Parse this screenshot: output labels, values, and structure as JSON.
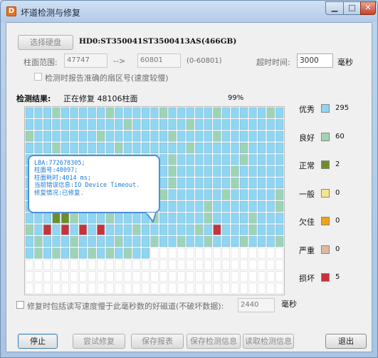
{
  "window": {
    "title": "坏道检测与修复",
    "app_icon_glyph": "D"
  },
  "disk": {
    "select_button": "选择硬盘",
    "name": "HD0:ST350041ST3500413AS(466GB)"
  },
  "range": {
    "label": "柱面范围:",
    "start": "47747",
    "arrow": "-->",
    "end": "60801",
    "total": "(0-60801)"
  },
  "timeout": {
    "label": "超时时间:",
    "value": "3000",
    "unit": "毫秒"
  },
  "accurate_check": {
    "label": "检测时报告准确的扇区号(速度较慢)"
  },
  "status": {
    "label": "检测结果:",
    "text": "正在修复 48106柱面",
    "percent": "99%"
  },
  "legend": [
    {
      "label": "优秀",
      "color": "#8ed6f2",
      "count": "295"
    },
    {
      "label": "良好",
      "color": "#9fd4b3",
      "count": "60"
    },
    {
      "label": "正常",
      "color": "#6f8e2a",
      "count": "2"
    },
    {
      "label": "一般",
      "color": "#f5e58f",
      "count": "0"
    },
    {
      "label": "欠佳",
      "color": "#f0a21c",
      "count": "0"
    },
    {
      "label": "严重",
      "color": "#d9bba3",
      "count": "0"
    },
    {
      "label": "损坏",
      "color": "#c8333a",
      "count": "5"
    }
  ],
  "tooltip": {
    "lba": "LBA:772678305;",
    "cylinder": "柱面号:48097;",
    "time": "柱面耗时:4014 ms;",
    "error": "当前错误信息:IO Device Timeout.",
    "repair": "修复情况:已修复."
  },
  "repair_option": {
    "label": "修复时包括读写速度慢于此毫秒数的好磁道(不破坏数据):",
    "value": "2440",
    "unit": "毫秒"
  },
  "buttons": {
    "stop": "停止",
    "try_repair": "尝试修复",
    "save_report": "保存报表",
    "save_info": "保存检测信息",
    "load_info": "读取检测信息",
    "exit": "退出"
  },
  "map": {
    "cols": 29,
    "rows": 16,
    "filled_cells": 362,
    "cell_colors": {
      "excellent": "#8ed6f2",
      "good": "#9fd4b3",
      "normal": "#6f8e2a",
      "bad": "#c8333a",
      "empty": "#ffffff"
    }
  }
}
